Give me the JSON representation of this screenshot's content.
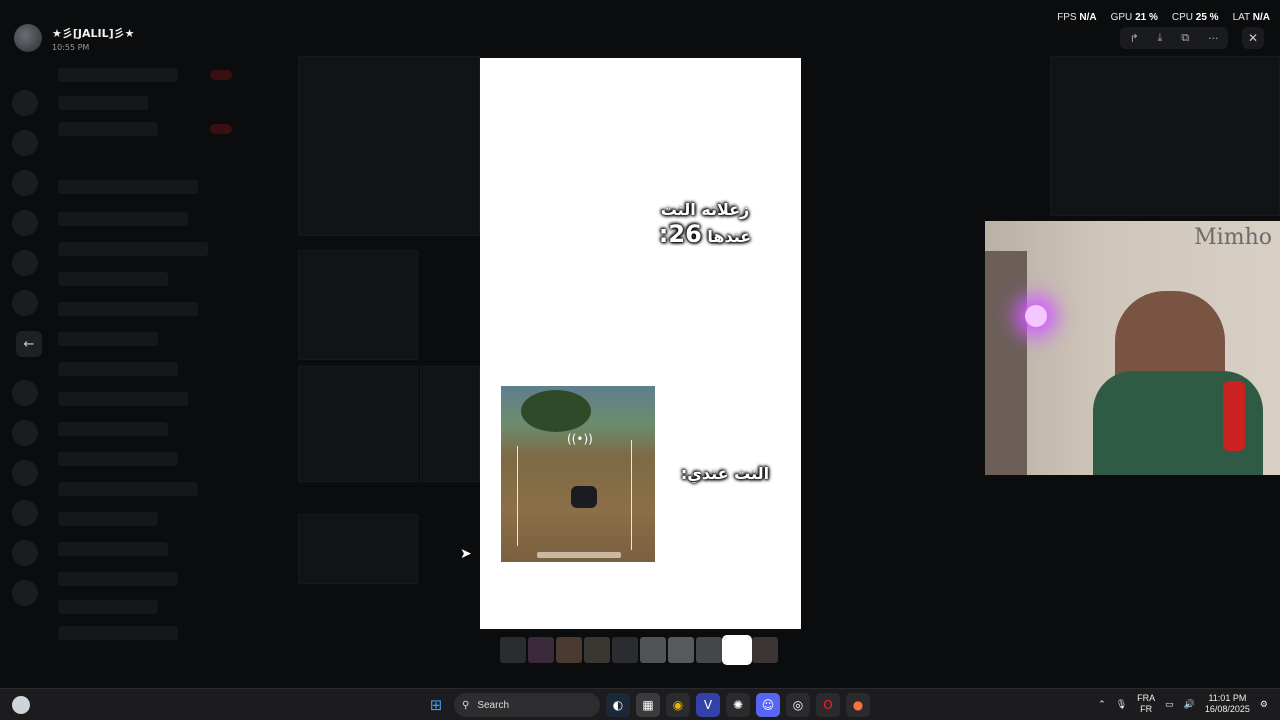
{
  "uploader": {
    "name": "★彡[JALIL]彡★",
    "time": "10:55 PM"
  },
  "stats": [
    {
      "label": "FPS",
      "value": "N/A"
    },
    {
      "label": "GPU",
      "value": "21 %"
    },
    {
      "label": "CPU",
      "value": "25 %"
    },
    {
      "label": "LAT",
      "value": "N/A"
    }
  ],
  "viewer_tools": {
    "forward_icon": "↱",
    "download_icon": "⤓",
    "open_icon": "⧉",
    "more_icon": "···",
    "close_icon": "✕",
    "prev_icon": "←"
  },
  "media": {
    "caption_top_line1": "زعلانه النت",
    "caption_top_line2_word": "عندها",
    "caption_top_line2_number": "26:",
    "caption_bottom": "النت عندي:"
  },
  "webcam": {
    "label": "Mimho"
  },
  "taskbar": {
    "search_label": "Search",
    "lang_top": "FRA",
    "lang_bottom": "FR",
    "time": "11:01 PM",
    "date": "16/08/2025"
  }
}
